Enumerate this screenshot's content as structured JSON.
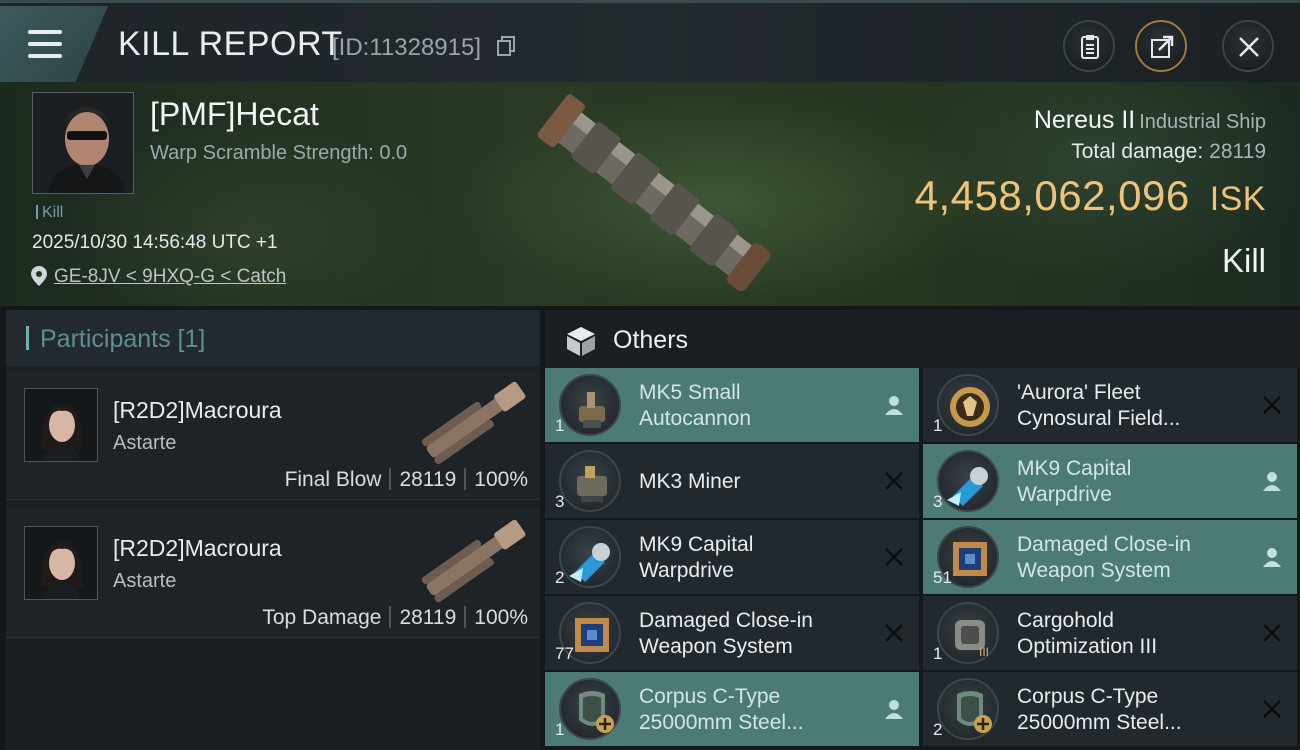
{
  "header": {
    "title": "KILL REPORT",
    "report_id": "[ID:11328915]"
  },
  "victim": {
    "name": "[PMF]Hecat",
    "warp_scramble": "Warp Scramble Strength: 0.0",
    "kill_tag": "Kill",
    "timestamp": "2025/10/30 14:56:48 UTC +1",
    "location": "GE-8JV < 9HXQ-G < Catch",
    "ship_name": "Nereus II",
    "ship_class": "Industrial Ship",
    "total_damage_label": "Total damage:",
    "total_damage": "28119",
    "isk_value": "4,458,062,096",
    "isk_unit": "ISK",
    "result": "Kill"
  },
  "participants": {
    "title": "Participants [1]",
    "list": [
      {
        "name": "[R2D2]Macroura",
        "ship": "Astarte",
        "role": "Final Blow",
        "damage": "28119",
        "percent": "100%"
      },
      {
        "name": "[R2D2]Macroura",
        "ship": "Astarte",
        "role": "Top Damage",
        "damage": "28119",
        "percent": "100%"
      }
    ]
  },
  "others": {
    "title": "Others",
    "items": [
      {
        "qty": "1",
        "line1": "MK5 Small",
        "line2": "Autocannon",
        "status": "dropped",
        "icon": "autocannon-icon"
      },
      {
        "qty": "1",
        "line1": "'Aurora' Fleet",
        "line2": "Cynosural Field...",
        "status": "destroyed",
        "icon": "cyno-icon"
      },
      {
        "qty": "3",
        "line1": "MK3 Miner",
        "line2": "",
        "status": "destroyed",
        "icon": "miner-icon"
      },
      {
        "qty": "3",
        "line1": "MK9 Capital",
        "line2": "Warpdrive",
        "status": "dropped",
        "icon": "warpdrive-icon"
      },
      {
        "qty": "2",
        "line1": "MK9 Capital",
        "line2": "Warpdrive",
        "status": "destroyed",
        "icon": "warpdrive-icon"
      },
      {
        "qty": "51",
        "line1": "Damaged Close-in",
        "line2": "Weapon System",
        "status": "dropped",
        "icon": "chip-icon"
      },
      {
        "qty": "77",
        "line1": "Damaged Close-in",
        "line2": "Weapon System",
        "status": "destroyed",
        "icon": "chip-icon"
      },
      {
        "qty": "1",
        "line1": "Cargohold",
        "line2": "Optimization III",
        "status": "destroyed",
        "icon": "cargohold-icon"
      },
      {
        "qty": "1",
        "line1": "Corpus C-Type",
        "line2": "25000mm Steel...",
        "status": "dropped",
        "icon": "armor-plate-icon"
      },
      {
        "qty": "2",
        "line1": "Corpus C-Type",
        "line2": "25000mm Steel...",
        "status": "destroyed",
        "icon": "armor-plate-icon"
      }
    ]
  },
  "colors": {
    "isk_gold": "#efc27a",
    "dropped_highlight": "#4c7a74",
    "accent_teal": "#6fb0b4"
  }
}
